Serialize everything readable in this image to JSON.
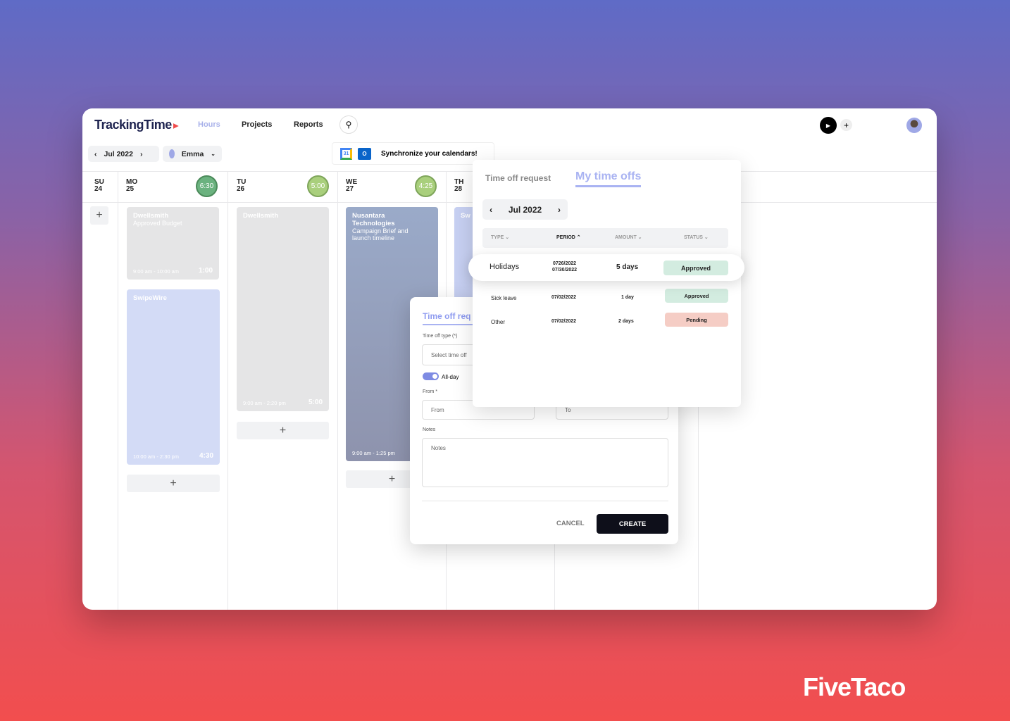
{
  "app": {
    "logo": "TrackingTime",
    "nav": [
      "Hours",
      "Projects",
      "Reports"
    ],
    "active_nav": "Hours"
  },
  "toolbar": {
    "month": "Jul 2022",
    "user": "Emma",
    "sync": "Synchronize your calendars!"
  },
  "days": [
    {
      "dow": "SU",
      "num": "24"
    },
    {
      "dow": "MO",
      "num": "25",
      "total": "6:30"
    },
    {
      "dow": "TU",
      "num": "26",
      "total": "5:00"
    },
    {
      "dow": "WE",
      "num": "27",
      "total": "4:25"
    },
    {
      "dow": "TH",
      "num": "28"
    }
  ],
  "cards": [
    {
      "title": "Dwellsmith",
      "desc": "Approved Budget",
      "time": "9:00 am - 10:00 am",
      "dur": "1:00"
    },
    {
      "title": "SwipeWire",
      "time": "10:00 am - 2:30 pm",
      "dur": "4:30"
    },
    {
      "title": "Dwellsmith",
      "time": "9:00 am - 2:20 pm",
      "dur": "5:00"
    },
    {
      "title": "Nusantara Technologies",
      "desc": "Campaign Brief and launch timeline",
      "time": "9:00 am - 1:25 pm"
    },
    {
      "title": "Sw"
    }
  ],
  "form": {
    "title": "Time off req",
    "type_label": "Time off type (*)",
    "type_placeholder": "Select time off",
    "allday": "All-day",
    "allday_on": true,
    "from_label": "From *",
    "from_placeholder": "From",
    "to_placeholder": "To",
    "notes_label": "Notes",
    "notes_placeholder": "Notes",
    "cancel": "CANCEL",
    "create": "CREATE"
  },
  "timeoffs": {
    "tabs": [
      "Time off request",
      "My time offs"
    ],
    "active_tab": "My time offs",
    "month": "Jul 2022",
    "columns": [
      "TYPE",
      "PERIOD",
      "AMOUNT",
      "STATUS"
    ],
    "rows": [
      {
        "type": "Holidays",
        "period": [
          "0726/2022",
          "07/30/2022"
        ],
        "amount": "5 days",
        "status": "Approved"
      },
      {
        "type": "Sick leave",
        "period": [
          "07/02/2022"
        ],
        "amount": "1 day",
        "status": "Approved"
      },
      {
        "type": "Other",
        "period": [
          "07/02/2022"
        ],
        "amount": "2 days",
        "status": "Pending"
      }
    ]
  },
  "watermark": "FiveTaco",
  "colors": {
    "approved": "#d3ece0",
    "pending": "#f5cdc5",
    "accent": "#8f9cf0"
  }
}
